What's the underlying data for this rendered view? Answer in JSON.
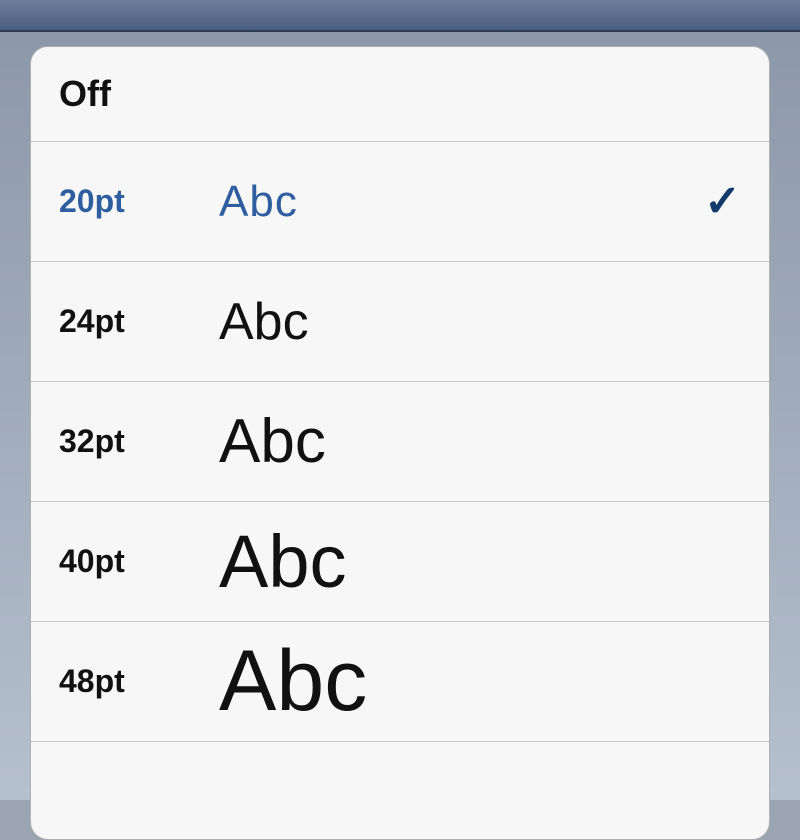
{
  "list": {
    "off_label": "Off",
    "sample_text": "Abc",
    "check_glyph": "✓",
    "options": [
      {
        "label": "20pt",
        "selected": true
      },
      {
        "label": "24pt",
        "selected": false
      },
      {
        "label": "32pt",
        "selected": false
      },
      {
        "label": "40pt",
        "selected": false
      },
      {
        "label": "48pt",
        "selected": false
      }
    ]
  }
}
